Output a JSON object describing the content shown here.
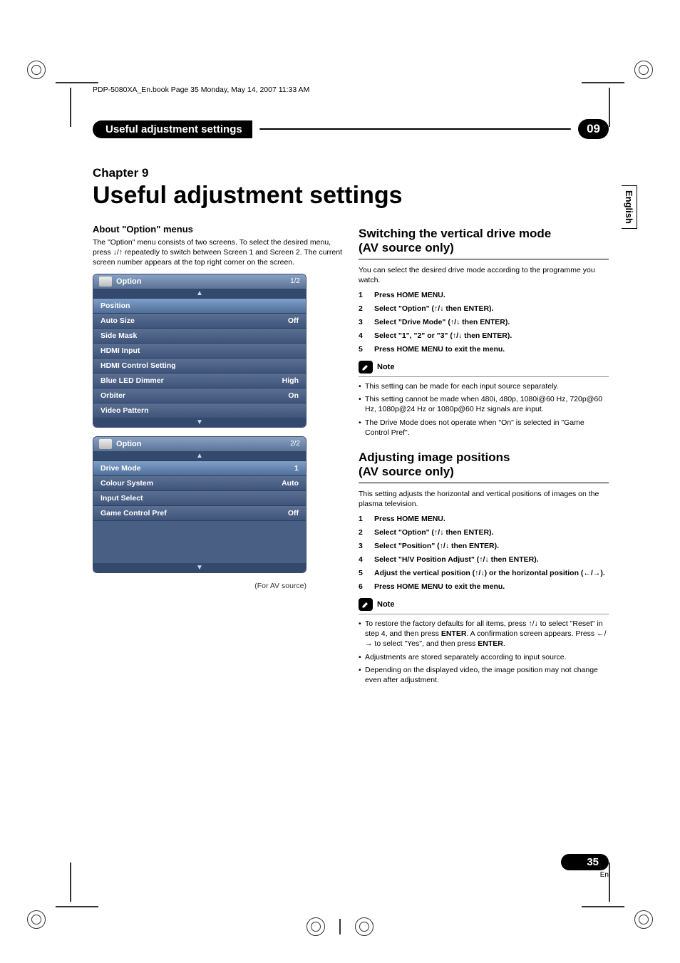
{
  "meta": {
    "bookline": "PDP-5080XA_En.book  Page 35  Monday, May 14, 2007  11:33 AM"
  },
  "header": {
    "title": "Useful adjustment settings",
    "chapter_badge": "09"
  },
  "lang_tab": "English",
  "chapter_line": "Chapter 9",
  "big_title": "Useful adjustment settings",
  "left": {
    "about_heading": "About \"Option\" menus",
    "about_body": "The \"Option\" menu consists of two screens. To select the desired menu, press ↓/↑ repeatedly to switch between Screen 1 and Screen 2. The current screen number appears at the top right corner on the screen.",
    "osd1": {
      "title": "Option",
      "page": "1/2",
      "rows": [
        {
          "label": "Position",
          "value": "",
          "sel": true
        },
        {
          "label": "Auto Size",
          "value": "Off"
        },
        {
          "label": "Side Mask",
          "value": ""
        },
        {
          "label": "HDMI Input",
          "value": ""
        },
        {
          "label": "HDMI Control Setting",
          "value": ""
        },
        {
          "label": "Blue LED Dimmer",
          "value": "High"
        },
        {
          "label": "Orbiter",
          "value": "On"
        },
        {
          "label": "Video Pattern",
          "value": ""
        }
      ]
    },
    "osd2": {
      "title": "Option",
      "page": "2/2",
      "rows": [
        {
          "label": "Drive Mode",
          "value": "1",
          "sel": true
        },
        {
          "label": "Colour System",
          "value": "Auto"
        },
        {
          "label": "Input Select",
          "value": ""
        },
        {
          "label": "Game Control Pref",
          "value": "Off"
        }
      ]
    },
    "caption": "(For AV source)"
  },
  "sectionA": {
    "title_l1": "Switching the vertical drive mode",
    "title_l2": "(AV source only)",
    "intro": "You can select the desired drive mode according to the programme you watch.",
    "steps": [
      "Press HOME MENU.",
      "Select \"Option\" (↑/↓ then ENTER).",
      "Select \"Drive Mode\" (↑/↓ then ENTER).",
      "Select  \"1\", \"2\" or \"3\" (↑/↓ then ENTER).",
      "Press HOME MENU to exit the menu."
    ],
    "note_label": "Note",
    "notes": [
      "This setting can be made for each input source separately.",
      "This setting cannot be made when 480i, 480p, 1080i@60 Hz, 720p@60 Hz, 1080p@24 Hz or 1080p@60 Hz signals are input.",
      "The Drive Mode does not operate when \"On\" is selected in \"Game Control Pref\"."
    ]
  },
  "sectionB": {
    "title_l1": "Adjusting image positions",
    "title_l2": "(AV source only)",
    "intro": "This setting adjusts the horizontal and vertical positions of images on the plasma television.",
    "steps": [
      "Press HOME MENU.",
      "Select \"Option\" (↑/↓ then ENTER).",
      "Select \"Position\" (↑/↓ then ENTER).",
      "Select \"H/V Position Adjust\" (↑/↓ then ENTER).",
      "Adjust the vertical position (↑/↓) or the horizontal position (←/→).",
      "Press HOME MENU to exit the menu."
    ],
    "note_label": "Note",
    "notes_rich": {
      "n1a": "To restore the factory defaults for all items, press ↑/↓ to select \"Reset\" in step 4, and then press ",
      "n1b": "ENTER",
      "n1c": ". A confirmation screen appears. Press ←/→ to select \"Yes\", and then press ",
      "n1d": "ENTER",
      "n1e": ".",
      "n2": "Adjustments are stored separately according to input source.",
      "n3": "Depending on the displayed video, the image position may not change even after adjustment."
    }
  },
  "footer": {
    "page": "35",
    "lang": "En"
  }
}
